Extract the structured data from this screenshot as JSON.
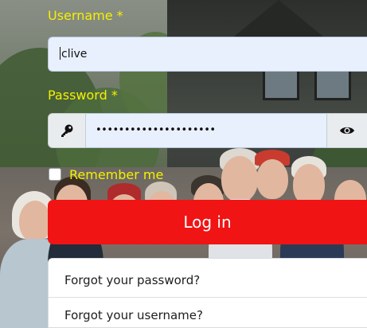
{
  "login": {
    "username_label": "Username *",
    "username_value": "clive",
    "password_label": "Password *",
    "password_value": "•••••••••••••••••••••",
    "key_icon": "key-icon",
    "show_password_icon": "eye-icon",
    "remember_label": "Remember me",
    "remember_checked": false,
    "login_label": "Log in",
    "forgot_password": "Forgot your password?",
    "forgot_username": "Forgot your username?"
  },
  "colors": {
    "label": "#f5f000",
    "login_button": "#f01414",
    "input_background": "#e8f0fe"
  }
}
